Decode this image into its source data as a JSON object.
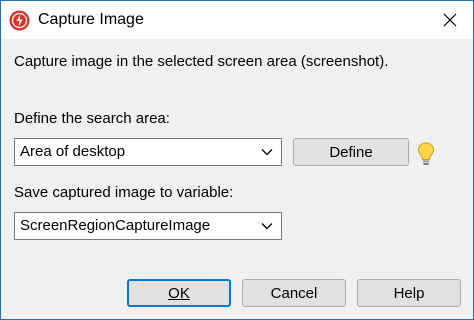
{
  "window": {
    "title": "Capture Image"
  },
  "content": {
    "description": "Capture image in the selected screen area (screenshot).",
    "search_area_label": "Define the search area:",
    "search_area_value": "Area of desktop",
    "define_button": "Define",
    "variable_label": "Save captured image to variable:",
    "variable_value": "ScreenRegionCaptureImage"
  },
  "buttons": {
    "ok": "OK",
    "cancel": "Cancel",
    "help": "Help"
  },
  "icons": {
    "app": "lightning-icon",
    "close": "close-icon",
    "dropdown": "chevron-down-icon",
    "hint": "lightbulb-icon"
  },
  "colors": {
    "app_icon_red": "#d9342b",
    "accent": "#0078d7",
    "bulb_yellow": "#ffd54a"
  }
}
